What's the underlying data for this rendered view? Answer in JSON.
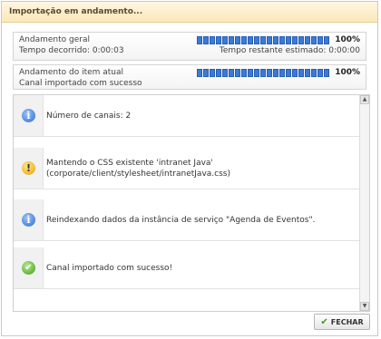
{
  "dialog": {
    "title": "Importação em andamento..."
  },
  "overall": {
    "label": "Andamento geral",
    "percent_text": "100%",
    "progress": 1.0,
    "elapsed": "Tempo decorrido: 0:00:03",
    "remaining": "Tempo restante estimado: 0:00:00"
  },
  "current": {
    "label": "Andamento do item atual",
    "percent_text": "100%",
    "progress": 1.0,
    "status": "Canal importado com sucesso"
  },
  "messages": [
    {
      "icon": "info-icon",
      "text": "Número de canais: 2"
    },
    {
      "icon": "warning-icon",
      "text": "Mantendo o CSS existente 'intranet Java' (corporate/client/stylesheet/intranetJava.css)"
    },
    {
      "icon": "info-icon",
      "text": "Reindexando dados da instância de serviço \"Agenda de Eventos\"."
    },
    {
      "icon": "success-icon",
      "text": "Canal importado com sucesso!"
    }
  ],
  "footer": {
    "close_label": "FECHAR"
  }
}
